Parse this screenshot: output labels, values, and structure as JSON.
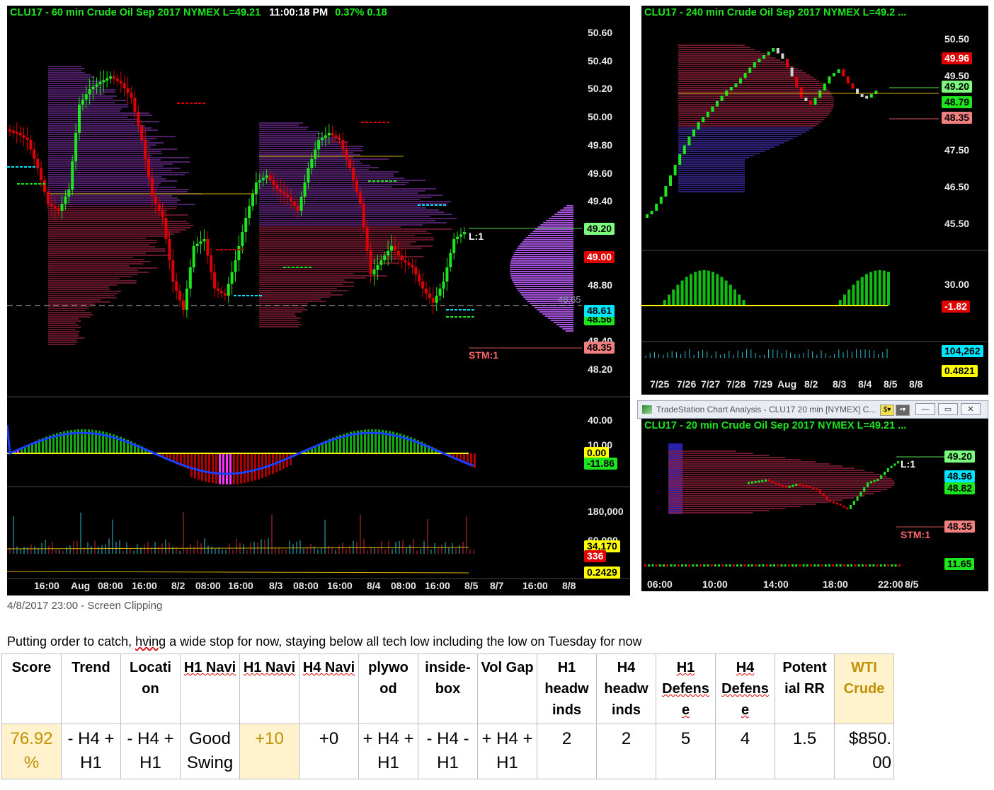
{
  "colors": {
    "green": "#1ee61e",
    "red": "#e00000",
    "cyan": "#00e5ff",
    "yellow": "#ffff00",
    "magenta": "#ff33ff",
    "gold": "#fff2cc"
  },
  "main_chart": {
    "title": "CLU17 - 60 min  Crude Oil Sep 2017  NYMEX  L=49.21",
    "time": "11:00:18 PM",
    "change": "0.37%  0.18",
    "price_ticks": [
      "50.60",
      "50.40",
      "50.20",
      "50.00",
      "49.80",
      "49.60",
      "49.40",
      "48.80",
      "48.40",
      "48.20"
    ],
    "badges": {
      "last": "49.20",
      "level1": "49.00",
      "level2": "48.61",
      "level3": "48.56",
      "level4": "48.35"
    },
    "marker_l": "L:1",
    "marker_stm": "STM:1",
    "faded": "48.65",
    "osc_ticks": [
      "40.00",
      "10.00"
    ],
    "osc_badges": {
      "a": "0.00",
      "b": "-11.86"
    },
    "vol_ticks": [
      "180,000",
      "60,000"
    ],
    "vol_badges": {
      "a": "34,170",
      "b": "336",
      "c": "0.2429"
    },
    "x_ticks": [
      "16:00",
      "Aug",
      "08:00",
      "16:00",
      "8/2",
      "08:00",
      "16:00",
      "8/3",
      "08:00",
      "16:00",
      "8/4",
      "08:00",
      "16:00",
      "8/5",
      "8/7",
      "16:00",
      "8/8"
    ]
  },
  "chart_240": {
    "title": "CLU17 - 240 min  Crude Oil Sep 2017  NYMEX  L=49.2 ...",
    "price_ticks": [
      "50.50",
      "49.50",
      "47.50",
      "46.50",
      "45.50"
    ],
    "badges": {
      "a": "49.96",
      "b": "49.20",
      "c": "48.79",
      "d": "48.35"
    },
    "osc_tick": "30.00",
    "osc_badge": "-1.82",
    "vol_badges": {
      "a": "104,262",
      "b": "0.4821"
    },
    "x_ticks": [
      "7/25",
      "7/26",
      "7/27",
      "7/28",
      "7/29",
      "Aug",
      "8/2",
      "8/3",
      "8/4",
      "8/5",
      "8/8"
    ]
  },
  "window": {
    "title": "TradeStation Chart Analysis - CLU17 20 min [NYMEX] C..."
  },
  "chart_20": {
    "title": "CLU17 - 20 min  Crude Oil Sep 2017  NYMEX  L=49.21  ...",
    "badges": {
      "a": "49.20",
      "b": "48.96",
      "c": "48.82",
      "d": "48.35",
      "e": "11.65"
    },
    "marker_l": "L:1",
    "marker_stm": "STM:1",
    "x_ticks": [
      "06:00",
      "10:00",
      "14:00",
      "18:00",
      "22:00",
      "8/5"
    ]
  },
  "caption": "4/8/2017 23:00 - Screen Clipping",
  "note": {
    "pre": "Putting order to catch, ",
    "sq": "hving",
    "post": " a wide stop for now, staying below all tech low including the low on Tuesday for now"
  },
  "table": {
    "headers": [
      "Score",
      "Trend",
      "Locati on",
      "H1 Navi",
      "H1 Navi",
      "H4 Navi",
      "plywo od",
      "inside- box",
      "Vol Gap",
      "H1 headw inds",
      "H4 headw inds",
      "H1 Defens e",
      "H4 Defens e",
      "Potent ial RR",
      "WTI Crude"
    ],
    "values": [
      "76.92 %",
      "- H4 + H1",
      "- H4 + H1",
      "Good Swing",
      "+10",
      "+0",
      "+ H4 + H1",
      "- H4 - H1",
      "+ H4 + H1",
      "2",
      "2",
      "5",
      "4",
      "1.5",
      "$850. 00"
    ]
  }
}
